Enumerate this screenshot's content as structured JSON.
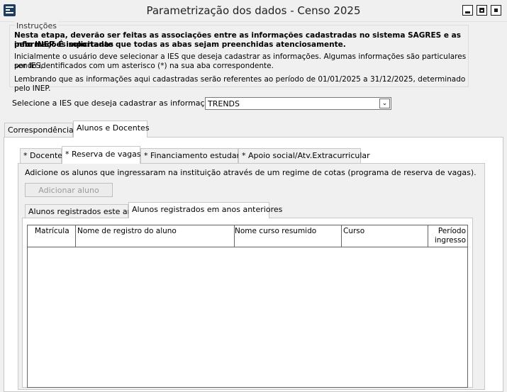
{
  "window": {
    "title": "Parametrização dos dados - Censo 2025",
    "icon": "app-menu-icon",
    "controls": [
      "minimize-icon",
      "maximize-icon",
      "close-icon"
    ]
  },
  "instructions": {
    "legend": "Instruções",
    "bold_line_1": "Nesta etapa, deverão ser feitas as associações entre as informações cadastradas no sistema SAGRES e as informações solicitadas",
    "bold_line_2": "pelo INEP. É importante que todas as abas sejam preenchidas atenciosamente.",
    "line_3": "Inicialmente o usuário deve selecionar a IES que deseja cadastrar as informações. Algumas informações são particulares por IES,",
    "line_4": "sendo identificados com um asterisco (*) na sua aba correspondente.",
    "line_5": "Lembrando que as informações aqui cadastradas serão referentes ao período de 01/01/2025 a 31/12/2025, determinado pelo INEP."
  },
  "ies": {
    "label": "Selecione a IES que deseja cadastrar as informações:",
    "selected": "TRENDS"
  },
  "main_tabs": [
    "Correspondências",
    "Alunos e Docentes"
  ],
  "sub_tabs": [
    "* Docente",
    "* Reserva de vagas",
    "* Financiamento estudantil",
    "* Apoio social/Atv.Extracurricular"
  ],
  "reserva": {
    "description": "Adicione os alunos que ingressaram na instituição através de um regime de cotas (programa de reserva de vagas).",
    "add_button": "Adicionar aluno",
    "inner_tabs": [
      "Alunos registrados este ano",
      "Alunos registrados em anos anteriores"
    ],
    "columns": [
      "Matrícula",
      "Nome de registro do aluno",
      "Nome curso resumido",
      "Curso",
      "Período ingresso"
    ],
    "rows": []
  }
}
